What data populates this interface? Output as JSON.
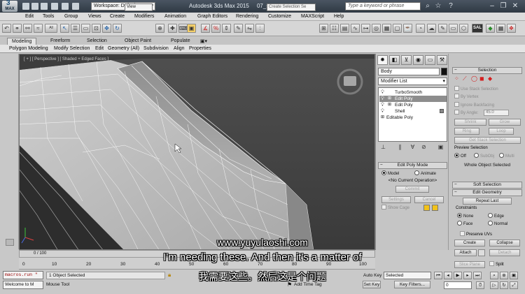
{
  "title_bar": {
    "app_title": "Autodesk 3ds Max 2015     07_start.max",
    "workspace": "Workspace: Default",
    "search_placeholder": "Type a keyword or phrase",
    "logo_text": "MAX"
  },
  "menu": [
    "Edit",
    "Tools",
    "Group",
    "Views",
    "Create",
    "Modifiers",
    "Animation",
    "Graph Editors",
    "Rendering",
    "Customize",
    "MAXScript",
    "Help"
  ],
  "toolbar": {
    "view_dropdown": "View",
    "selection_set_placeholder": "Create Selection Se"
  },
  "ribbon": {
    "tabs": [
      "Modeling",
      "Freeform",
      "Selection",
      "Object Paint",
      "Populate"
    ],
    "sub_items": [
      "Polygon Modeling",
      "Modify Selection",
      "Edit",
      "Geometry (All)",
      "Subdivision",
      "Align",
      "Properties"
    ]
  },
  "viewport": {
    "label": "[ + ] [ Perspective ] [ Shaded + Edged Faces ]"
  },
  "command_panel": {
    "object_name": "Body",
    "modifier_list": "Modifier List",
    "stack": [
      {
        "label": "TurboSmooth",
        "selected": false
      },
      {
        "label": "Edit Poly",
        "selected": true
      },
      {
        "label": "Edit Poly",
        "selected": false
      },
      {
        "label": "Shell",
        "selected": false
      },
      {
        "label": "Editable Poly",
        "selected": false
      }
    ],
    "edit_poly_mode": {
      "title": "Edit Poly Mode",
      "model": "Model",
      "animate": "Animate",
      "current_op": "<No Current Operation>",
      "commit": "Commit",
      "settings": "Settings",
      "cancel": "Cancel",
      "show_cage": "Show Cage"
    }
  },
  "selection_rollout": {
    "title": "Selection",
    "use_stack": "Use Stack Selection",
    "by_vertex": "By Vertex",
    "ignore_backfacing": "Ignore Backfacing",
    "by_angle": "By Angle:",
    "angle_value": "45.0",
    "shrink": "Shrink",
    "grow": "Grow",
    "ring": "Ring",
    "loop": "Loop",
    "get_stack": "Get Stack Selection",
    "preview_title": "Preview Selection",
    "off": "Off",
    "subobj": "SubObj",
    "multi": "Multi",
    "whole_object": "Whole Object Selected"
  },
  "soft_selection": {
    "title": "Soft Selection"
  },
  "edit_geometry": {
    "title": "Edit Geometry",
    "repeat_last": "Repeat Last",
    "constraints": "Constraints",
    "none": "None",
    "edge": "Edge",
    "face": "Face",
    "normal": "Normal",
    "preserve_uvs": "Preserve UVs",
    "create": "Create",
    "collapse": "Collapse",
    "attach": "Attach",
    "detach": "Detach",
    "slice_plane": "Slice Plane",
    "split": "Split"
  },
  "timeline": {
    "slider": "0 / 100",
    "ticks": [
      "0",
      "10",
      "20",
      "30",
      "40",
      "50",
      "60",
      "70",
      "80",
      "90",
      "100"
    ]
  },
  "status": {
    "maxscript_line1": "macros.run \"",
    "maxscript_line2": "Welcome to M",
    "selection_count": "1 Object Selected",
    "prompt": "Mouse Tool",
    "add_time_tag": "Add Time Tag",
    "auto_key": "Auto Key",
    "set_key": "Set Key",
    "selected_dropdown": "Selected",
    "key_filters": "Key Filters...",
    "frame": "0"
  },
  "subtitles": {
    "url": "www.yuyulaoshi.com",
    "english": "I'm needing these. And then it's a matter of",
    "chinese": "我需要这些。然后这是个问题"
  },
  "colors": {
    "swatch_yellow": "#f2c21a",
    "selection_icon_red": "#d42020",
    "selected_row": "#8d8d8d",
    "viewport_bg": "#464646"
  }
}
